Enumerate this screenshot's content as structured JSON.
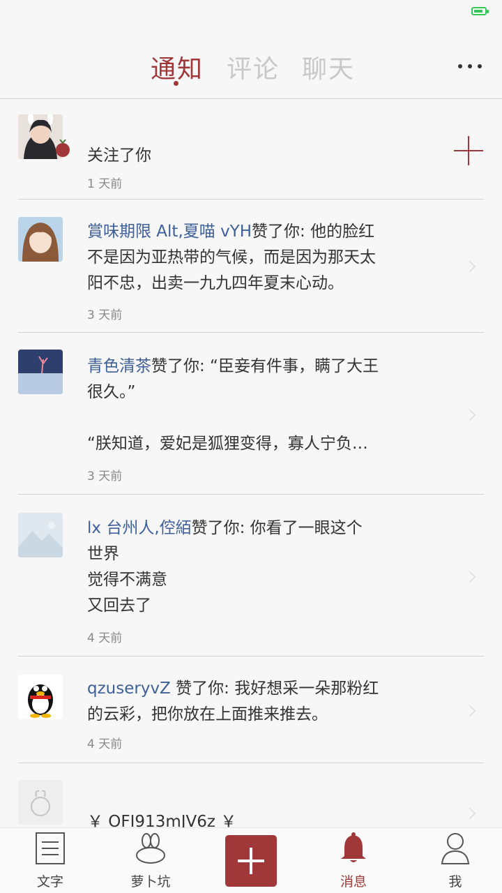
{
  "tabs": [
    {
      "label": "通知",
      "active": true
    },
    {
      "label": "评论",
      "active": false
    },
    {
      "label": "聊天",
      "active": false
    }
  ],
  "colors": {
    "accent": "#a0383a",
    "link": "#3d5f9a"
  },
  "notifications": [
    {
      "text": "关注了你",
      "time": "1 天前",
      "icon": "follow-plus-icon"
    },
    {
      "name": "賞味期限 Alt,夏喵 vYH",
      "text": "赞了你: 他的脸红\n不是因为亚热带的气候，而是因为那天太\n阳不忠，出卖一九九四年夏末心动。",
      "time": "3 天前"
    },
    {
      "name": "青色清茶",
      "text": "赞了你: “臣妾有件事，瞒了大王\n很久。”\n\n“朕知道，爱妃是狐狸变得，寡人宁负…",
      "time": "3 天前"
    },
    {
      "name": "lx 台州人,倥絔",
      "text": "赞了你: 你看了一眼这个\n世界\n觉得不满意\n又回去了",
      "time": "4 天前"
    },
    {
      "name": "qzuseryvZ",
      "text": " 赞了你: 我好想采一朵那粉红\n的云彩，把你放在上面推来推去。",
      "time": "4 天前"
    },
    {
      "text": "￥ OFI913mJV6z ￥"
    }
  ],
  "tabbar": [
    {
      "label": "文字",
      "icon": "document-icon"
    },
    {
      "label": "萝卜坑",
      "icon": "radish-icon"
    },
    {
      "label": "",
      "icon": "compose-plus-icon"
    },
    {
      "label": "消息",
      "icon": "bell-icon",
      "active": true
    },
    {
      "label": "我",
      "icon": "person-icon"
    }
  ]
}
